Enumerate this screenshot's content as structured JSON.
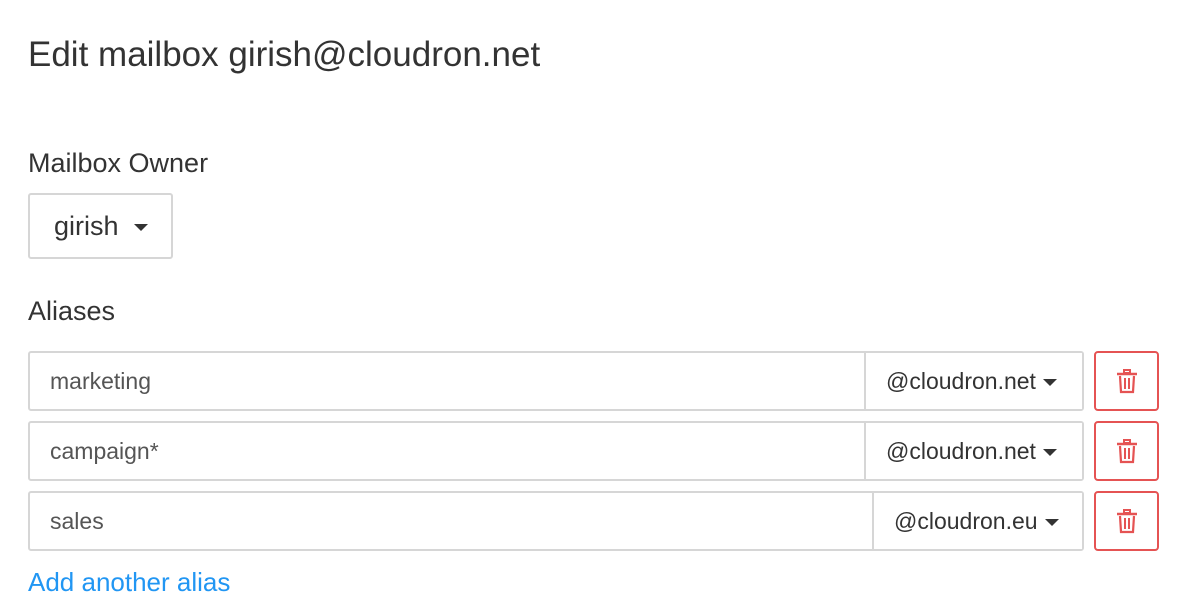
{
  "page": {
    "title": "Edit mailbox girish@cloudron.net"
  },
  "owner": {
    "label": "Mailbox Owner",
    "selected": "girish",
    "icon": "caret-down-icon"
  },
  "aliases": {
    "label": "Aliases",
    "items": [
      {
        "name": "marketing",
        "domain": "@cloudron.net"
      },
      {
        "name": "campaign*",
        "domain": "@cloudron.net"
      },
      {
        "name": "sales",
        "domain": "@cloudron.eu"
      }
    ],
    "delete_icon": "trash-icon",
    "add_link": "Add another alias"
  },
  "colors": {
    "text": "#333333",
    "border": "#d6d6d6",
    "danger": "#e55353",
    "link": "#2196f3"
  }
}
